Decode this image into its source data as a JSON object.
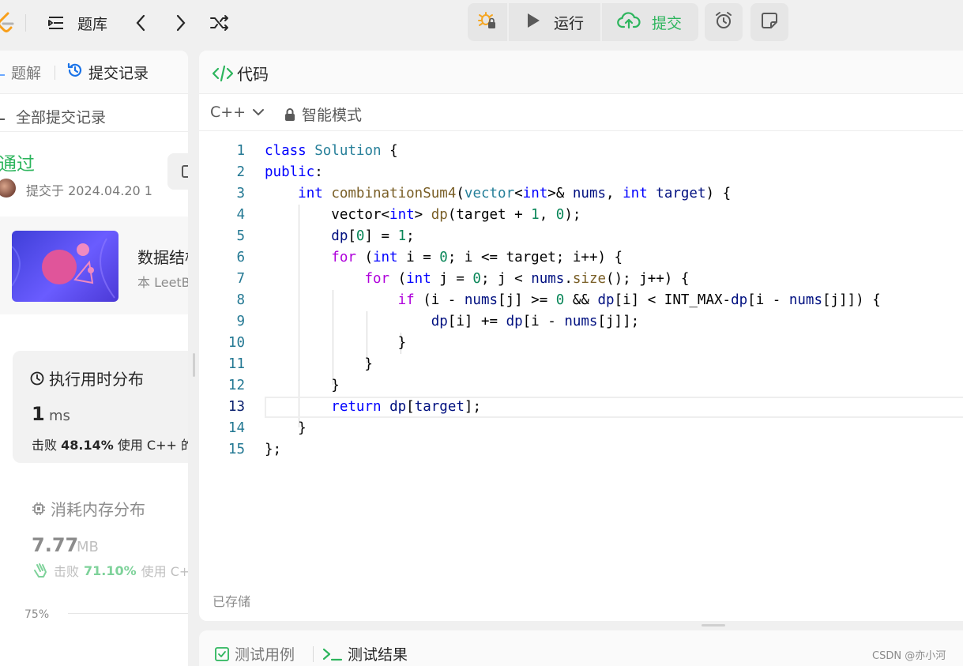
{
  "topbar": {
    "problem_list_label": "题库",
    "run_label": "运行",
    "submit_label": "提交"
  },
  "left_panel": {
    "tabs": {
      "solution": "题解",
      "submissions": "提交记录"
    },
    "back_label": "全部提交记录",
    "status": "通过",
    "submitted_at": "提交于 2024.04.20 1",
    "course": {
      "title": "数据结构",
      "subtitle": "本 LeetB"
    },
    "runtime_card": {
      "title": "执行用时分布",
      "value": "1",
      "unit": "ms",
      "beats_prefix": "击败",
      "beats_percent": "48.14%",
      "beats_suffix": "使用 C++ 的"
    },
    "memory_card": {
      "title": "消耗内存分布",
      "value": "7.77",
      "unit": "MB",
      "beats_prefix": "击败",
      "beats_percent": "71.10%",
      "beats_suffix": "使用 C++"
    },
    "axis_label": "75%"
  },
  "editor": {
    "title": "代码",
    "language": "C++",
    "mode": "智能模式",
    "saved_status": "已存储",
    "line_numbers": [
      "1",
      "2",
      "3",
      "4",
      "5",
      "6",
      "7",
      "8",
      "9",
      "10",
      "11",
      "12",
      "13",
      "14",
      "15"
    ],
    "current_line": 13
  },
  "bottom_panel": {
    "testcase_tab": "测试用例",
    "result_tab": "测试结果"
  },
  "watermark": "CSDN @亦小河",
  "colors": {
    "accent_green": "#2db55d",
    "panel_bg": "#ffffff",
    "app_bg": "#f0f0f0"
  }
}
